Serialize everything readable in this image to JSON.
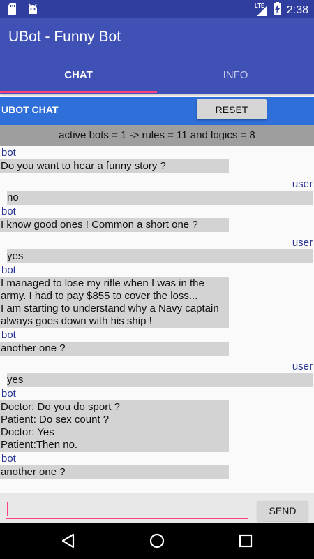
{
  "status_bar": {
    "time": "2:38",
    "network": "LTE",
    "icons": [
      "sd-card-icon",
      "android-icon",
      "signal-icon",
      "battery-charging-icon"
    ]
  },
  "app_bar": {
    "title": "UBot - Funny Bot"
  },
  "tabs": [
    {
      "label": "CHAT",
      "selected": true
    },
    {
      "label": "INFO",
      "selected": false
    }
  ],
  "chat_header": {
    "title": "UBOT CHAT",
    "reset_label": "RESET"
  },
  "stats": "active bots = 1 -> rules = 11 and logics = 8",
  "messages": [
    {
      "sender": "bot",
      "text": "Do you want to hear a funny story ?"
    },
    {
      "sender": "user",
      "text": "no"
    },
    {
      "sender": "bot",
      "text": "I know good ones ! Common a short one ?"
    },
    {
      "sender": "user",
      "text": "yes"
    },
    {
      "sender": "bot",
      "text": "I managed to lose my rifle when I was in the army. I had to pay $855 to cover the loss...\nI am starting to understand why a Navy captain always goes down with his ship !"
    },
    {
      "sender": "bot",
      "text": "another one ?"
    },
    {
      "sender": "user",
      "text": "yes"
    },
    {
      "sender": "bot",
      "text": "Doctor: Do you do sport ?\nPatient: Do sex count ?\nDoctor: Yes\nPatient:Then no."
    },
    {
      "sender": "bot",
      "text": "another one ?"
    }
  ],
  "input": {
    "value": "",
    "placeholder": ""
  },
  "send_label": "SEND",
  "colors": {
    "status_bar": "#303f9f",
    "primary": "#3f51b5",
    "accent": "#ff4081",
    "chat_header": "#2f6fd9",
    "sender_label": "#283593"
  }
}
